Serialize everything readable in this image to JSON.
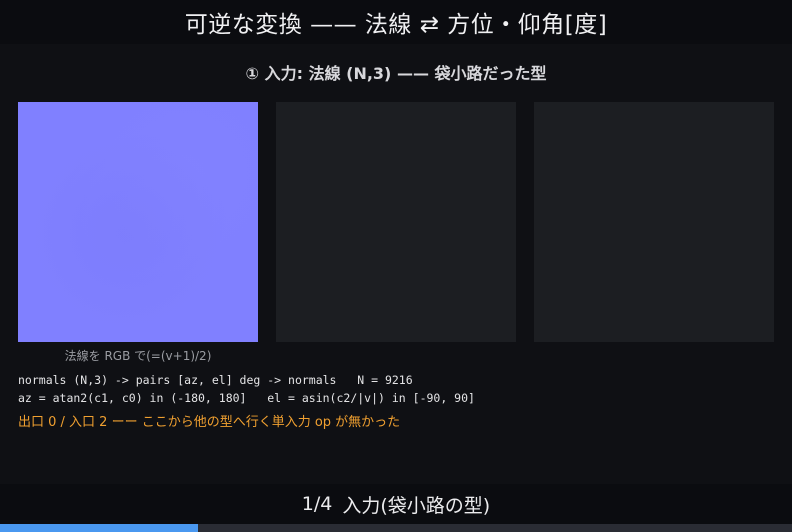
{
  "title": "可逆な変換 —— 法線 ⇄ 方位・仰角[度]",
  "section_heading": "① 入力: 法線 (N,3) —— 袋小路だった型",
  "panels": {
    "normals_color": "#8080ff",
    "empty_color": "#1c1e22",
    "caption": "法線を RGB で(=(v+1)/2)"
  },
  "info": {
    "line1": "normals (N,3) -> pairs [az, el] deg -> normals   N = 9216",
    "line2": "az = atan2(c1, c0) in (-180, 180]   el = asin(c2/|v|) in [-90, 90]"
  },
  "warning": {
    "text": "出口 0 / 入口 2 ーー ここから他の型へ行く単入力 op が無かった",
    "color": "#f0a030"
  },
  "footer": {
    "step": "1/4",
    "label": "入力(袋小路の型)"
  },
  "progress": {
    "value": 0.25,
    "color": "#4a98f0"
  }
}
